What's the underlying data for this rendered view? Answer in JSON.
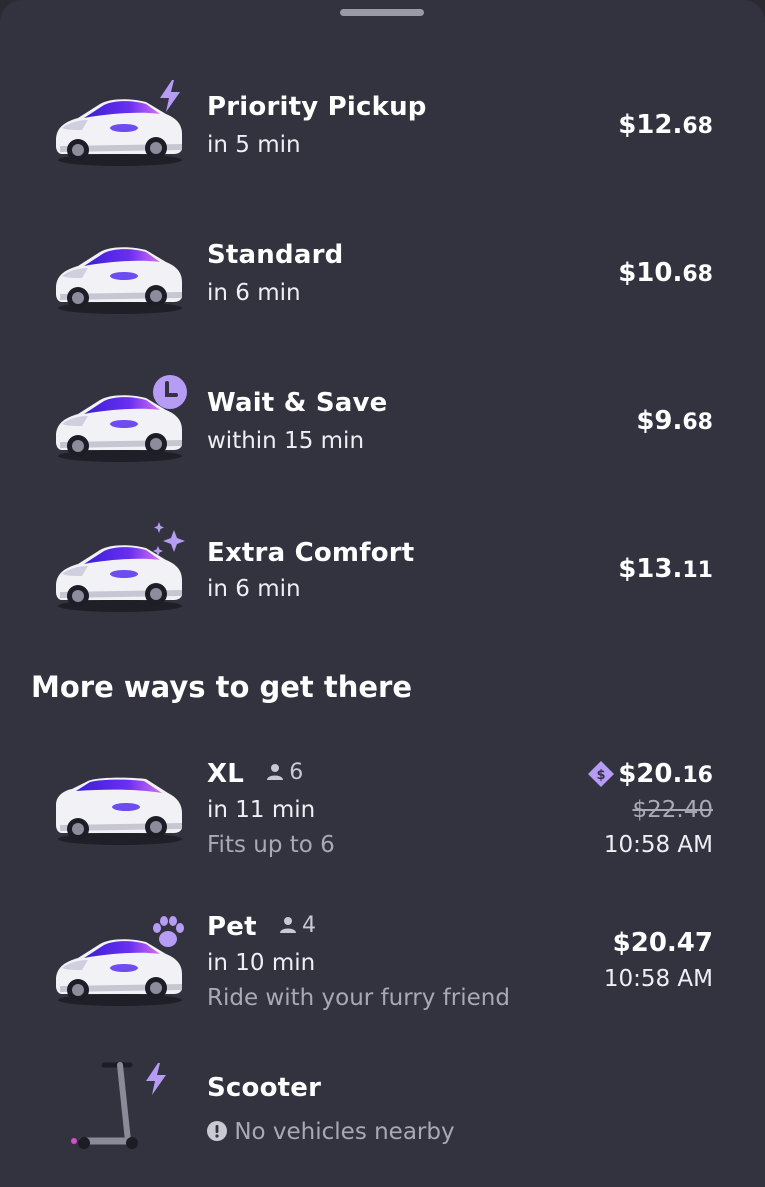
{
  "colors": {
    "background": "#33333f",
    "accent": "#b69cf5",
    "text": "#ffffff",
    "muted": "#a9a9b6"
  },
  "rides": [
    {
      "name": "Priority Pickup",
      "eta": "in 5 min",
      "price": "$12.",
      "cents": "68",
      "badge_icon": "lightning-icon"
    },
    {
      "name": "Standard",
      "eta": "in 6 min",
      "price": "$10.",
      "cents": "68"
    },
    {
      "name": "Wait & Save",
      "eta": "within 15 min",
      "price": "$9.",
      "cents": "68",
      "badge_icon": "clock-icon"
    },
    {
      "name": "Extra Comfort",
      "eta": "in 6 min",
      "price": "$13.",
      "cents": "11",
      "badge_icon": "sparkle-icon"
    }
  ],
  "more": {
    "title": "More ways to get there",
    "xl": {
      "name": "XL",
      "capacity": "6",
      "eta": "in 11 min",
      "subtitle": "Fits up to 6",
      "price": "$20.",
      "cents": "16",
      "original_price": "$22.40",
      "time": "10:58 AM",
      "badge_icon": "discount-tag-icon"
    },
    "pet": {
      "name": "Pet",
      "capacity": "4",
      "eta": "in 10 min",
      "subtitle": "Ride with your furry friend",
      "price": "$20.47",
      "time": "10:58 AM",
      "badge_icon": "paw-icon"
    },
    "scooter": {
      "name": "Scooter",
      "status": "No vehicles nearby",
      "badge_icon": "lightning-icon",
      "status_icon": "alert-icon"
    }
  }
}
